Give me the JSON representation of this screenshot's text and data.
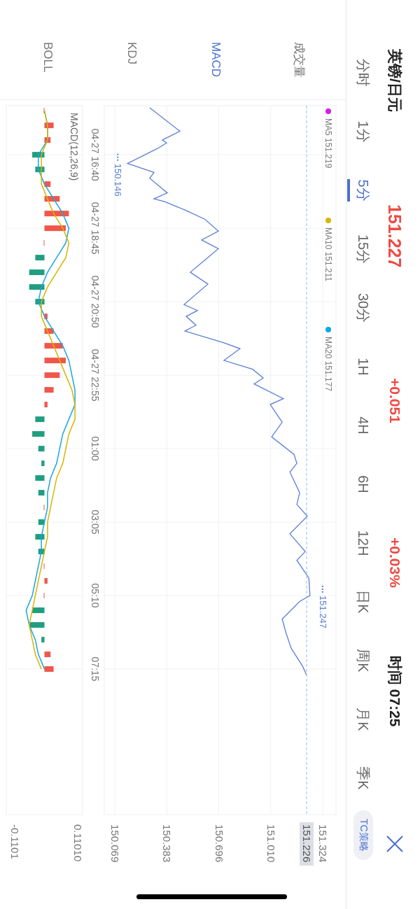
{
  "header": {
    "title": "英镑/日元",
    "price": "151.227",
    "change": "+0.051",
    "change_pct": "+0.03%",
    "time": "时间 07:25"
  },
  "periods": [
    {
      "label": "分时",
      "selected": false
    },
    {
      "label": "1分",
      "selected": false
    },
    {
      "label": "5分",
      "selected": true
    },
    {
      "label": "15分",
      "selected": false
    },
    {
      "label": "30分",
      "selected": false
    },
    {
      "label": "1H",
      "selected": false
    },
    {
      "label": "4H",
      "selected": false
    },
    {
      "label": "6H",
      "selected": false
    },
    {
      "label": "12H",
      "selected": false
    },
    {
      "label": "日K",
      "selected": false
    },
    {
      "label": "周K",
      "selected": false
    },
    {
      "label": "月K",
      "selected": false
    },
    {
      "label": "季K",
      "selected": false
    }
  ],
  "strategy_button": "TC策略",
  "indicators": [
    {
      "label": "成交量",
      "selected": false
    },
    {
      "label": "MACD",
      "selected": true
    },
    {
      "label": "KDJ",
      "selected": false
    },
    {
      "label": "BOLL",
      "selected": false
    }
  ],
  "main_chart": {
    "legend": [
      {
        "label": "MA5 151.219",
        "color": "#d41ee0"
      },
      {
        "label": "MA10 151.211",
        "color": "#d9b400"
      },
      {
        "label": "MA20 151.177",
        "color": "#10a8e8"
      }
    ],
    "y_axis_labels": [
      "151.324",
      "151.010",
      "150.696",
      "150.383",
      "150.069"
    ],
    "current_price": "151.226",
    "low_label": "150.146",
    "high_label": "151.247",
    "time_labels": [
      "04-27 16:40",
      "04-27 18:45",
      "04-27 20:50",
      "04-27 22:55",
      "01:00",
      "03:05",
      "05:10",
      "07:15"
    ]
  },
  "macd_chart": {
    "title": "MACD(12,26,9)",
    "y_axis_labels": [
      "0.11010",
      "-0.1101"
    ]
  }
}
